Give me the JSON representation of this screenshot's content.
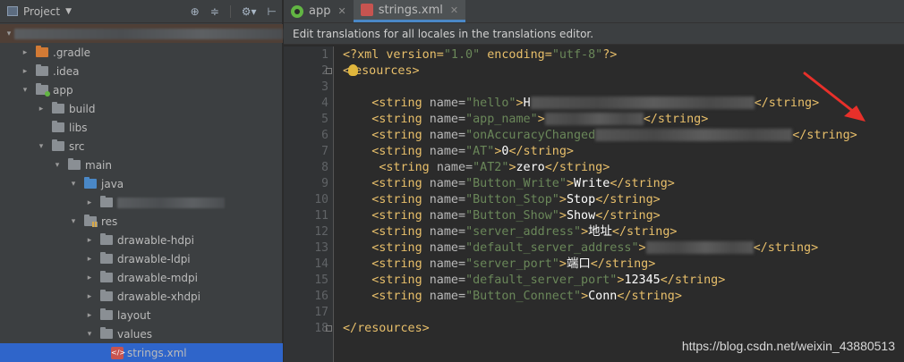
{
  "project_panel": {
    "title": "Project",
    "tree": [
      {
        "label": "",
        "depth": 0,
        "arrow": "▾",
        "folder": "",
        "blurred_width": 300,
        "dirty": true
      },
      {
        "label": ".gradle",
        "depth": 1,
        "arrow": "▸",
        "folder": "orange"
      },
      {
        "label": ".idea",
        "depth": 1,
        "arrow": "▸",
        "folder": "grey"
      },
      {
        "label": "app",
        "depth": 1,
        "arrow": "▾",
        "folder": "green"
      },
      {
        "label": "build",
        "depth": 2,
        "arrow": "▸",
        "folder": "grey"
      },
      {
        "label": "libs",
        "depth": 2,
        "arrow": "",
        "folder": "grey"
      },
      {
        "label": "src",
        "depth": 2,
        "arrow": "▾",
        "folder": "grey"
      },
      {
        "label": "main",
        "depth": 3,
        "arrow": "▾",
        "folder": "grey"
      },
      {
        "label": "java",
        "depth": 4,
        "arrow": "▾",
        "folder": "blue"
      },
      {
        "label": "",
        "depth": 5,
        "arrow": "▸",
        "folder": "grey",
        "blurred_width": 120
      },
      {
        "label": "res",
        "depth": 4,
        "arrow": "▾",
        "folder": "res"
      },
      {
        "label": "drawable-hdpi",
        "depth": 5,
        "arrow": "▸",
        "folder": "grey"
      },
      {
        "label": "drawable-ldpi",
        "depth": 5,
        "arrow": "▸",
        "folder": "grey"
      },
      {
        "label": "drawable-mdpi",
        "depth": 5,
        "arrow": "▸",
        "folder": "grey"
      },
      {
        "label": "drawable-xhdpi",
        "depth": 5,
        "arrow": "▸",
        "folder": "grey"
      },
      {
        "label": "layout",
        "depth": 5,
        "arrow": "▸",
        "folder": "grey"
      },
      {
        "label": "values",
        "depth": 5,
        "arrow": "▾",
        "folder": "grey"
      },
      {
        "label": "strings.xml",
        "depth": 6,
        "arrow": "",
        "folder": "xml",
        "selected": true
      }
    ]
  },
  "tabs": [
    {
      "label": "app",
      "icon": "app-module-icon",
      "active": false
    },
    {
      "label": "strings.xml",
      "icon": "xml-file-icon",
      "active": true
    }
  ],
  "banner": "Edit translations for all locales in the translations editor.",
  "lines": [
    {
      "n": "1",
      "seg": [
        [
          "decl",
          "<?xml version="
        ],
        [
          "val",
          "\"1.0\""
        ],
        [
          "decl",
          " encoding="
        ],
        [
          "val",
          "\"utf-8\""
        ],
        [
          "decl",
          "?>"
        ]
      ]
    },
    {
      "n": "2",
      "seg": [
        [
          "tag",
          "<"
        ],
        [
          "bulb",
          ""
        ],
        [
          "tag",
          "esources>"
        ]
      ]
    },
    {
      "n": "3",
      "seg": []
    },
    {
      "n": "4",
      "seg": [
        [
          "pad",
          "    "
        ],
        [
          "tag",
          "<string "
        ],
        [
          "attr",
          "name="
        ],
        [
          "val",
          "\"hello\""
        ],
        [
          "tag",
          ">"
        ],
        [
          "txt",
          "H"
        ],
        [
          "blur",
          "250"
        ],
        [
          "tag",
          "</string>"
        ]
      ]
    },
    {
      "n": "5",
      "seg": [
        [
          "pad",
          "    "
        ],
        [
          "tag",
          "<string "
        ],
        [
          "attr",
          "name="
        ],
        [
          "val",
          "\"app_name\""
        ],
        [
          "tag",
          ">"
        ],
        [
          "blur",
          "110"
        ],
        [
          "tag",
          "</string>"
        ]
      ]
    },
    {
      "n": "6",
      "seg": [
        [
          "pad",
          "    "
        ],
        [
          "tag",
          "<string "
        ],
        [
          "attr",
          "name="
        ],
        [
          "val",
          "\"onAccuracyChanged"
        ],
        [
          "blur",
          "220"
        ],
        [
          "tag",
          "</string>"
        ]
      ]
    },
    {
      "n": "7",
      "seg": [
        [
          "pad",
          "    "
        ],
        [
          "tag",
          "<string "
        ],
        [
          "attr",
          "name="
        ],
        [
          "val",
          "\"AT\""
        ],
        [
          "tag",
          ">"
        ],
        [
          "txt",
          "0"
        ],
        [
          "tag",
          "</string>"
        ]
      ]
    },
    {
      "n": "8",
      "seg": [
        [
          "pad",
          "     "
        ],
        [
          "tag",
          "<string "
        ],
        [
          "attr",
          "name="
        ],
        [
          "val",
          "\"AT2\""
        ],
        [
          "tag",
          ">"
        ],
        [
          "txt",
          "zero"
        ],
        [
          "tag",
          "</string>"
        ]
      ]
    },
    {
      "n": "9",
      "seg": [
        [
          "pad",
          "    "
        ],
        [
          "tag",
          "<string "
        ],
        [
          "attr",
          "name="
        ],
        [
          "val",
          "\"Button_Write\""
        ],
        [
          "tag",
          ">"
        ],
        [
          "txt",
          "Write"
        ],
        [
          "tag",
          "</string>"
        ]
      ]
    },
    {
      "n": "10",
      "seg": [
        [
          "pad",
          "    "
        ],
        [
          "tag",
          "<string "
        ],
        [
          "attr",
          "name="
        ],
        [
          "val",
          "\"Button_Stop\""
        ],
        [
          "tag",
          ">"
        ],
        [
          "txt",
          "Stop"
        ],
        [
          "tag",
          "</string>"
        ]
      ]
    },
    {
      "n": "11",
      "seg": [
        [
          "pad",
          "    "
        ],
        [
          "tag",
          "<string "
        ],
        [
          "attr",
          "name="
        ],
        [
          "val",
          "\"Button_Show\""
        ],
        [
          "tag",
          ">"
        ],
        [
          "txt",
          "Show"
        ],
        [
          "tag",
          "</string>"
        ]
      ]
    },
    {
      "n": "12",
      "seg": [
        [
          "pad",
          "    "
        ],
        [
          "tag",
          "<string "
        ],
        [
          "attr",
          "name="
        ],
        [
          "val",
          "\"server_address\""
        ],
        [
          "tag",
          ">"
        ],
        [
          "txt",
          "地址"
        ],
        [
          "tag",
          "</string>"
        ]
      ]
    },
    {
      "n": "13",
      "seg": [
        [
          "pad",
          "    "
        ],
        [
          "tag",
          "<string "
        ],
        [
          "attr",
          "name="
        ],
        [
          "val",
          "\"default_server_address\""
        ],
        [
          "tag",
          ">"
        ],
        [
          "blur",
          "120"
        ],
        [
          "tag",
          "</string>"
        ]
      ]
    },
    {
      "n": "14",
      "seg": [
        [
          "pad",
          "    "
        ],
        [
          "tag",
          "<string "
        ],
        [
          "attr",
          "name="
        ],
        [
          "val",
          "\"server_port\""
        ],
        [
          "tag",
          ">"
        ],
        [
          "txt",
          "端口"
        ],
        [
          "tag",
          "</string>"
        ]
      ]
    },
    {
      "n": "15",
      "seg": [
        [
          "pad",
          "    "
        ],
        [
          "tag",
          "<string "
        ],
        [
          "attr",
          "name="
        ],
        [
          "val",
          "\"default_server_port\""
        ],
        [
          "tag",
          ">"
        ],
        [
          "txt",
          "12345"
        ],
        [
          "tag",
          "</string>"
        ]
      ]
    },
    {
      "n": "16",
      "seg": [
        [
          "pad",
          "    "
        ],
        [
          "tag",
          "<string "
        ],
        [
          "attr",
          "name="
        ],
        [
          "val",
          "\"Button_Connect\""
        ],
        [
          "tag",
          ">"
        ],
        [
          "txt",
          "Conn"
        ],
        [
          "tag",
          "</string>"
        ]
      ]
    },
    {
      "n": "17",
      "seg": []
    },
    {
      "n": "18",
      "seg": [
        [
          "tag",
          "</resources>"
        ]
      ]
    }
  ],
  "watermark": "https://blog.csdn.net/weixin_43880513",
  "colors": {
    "tag": "#e8bf6a",
    "attr": "#bababa",
    "value": "#6a8759",
    "text": "#ffffff",
    "arrow": "#e8302a",
    "selection": "#2f65ca"
  }
}
